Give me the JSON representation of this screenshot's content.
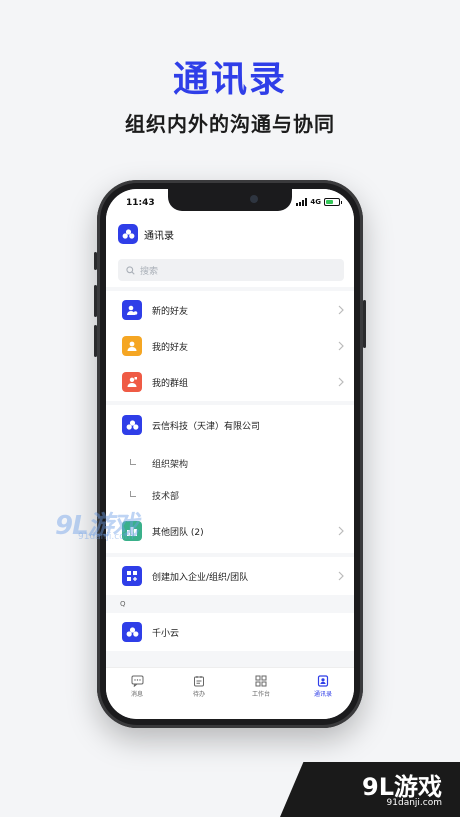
{
  "hero": {
    "title": "通讯录",
    "subtitle": "组织内外的沟通与协同"
  },
  "status": {
    "time": "11:43",
    "network": "4G"
  },
  "header": {
    "title": "通讯录"
  },
  "search": {
    "placeholder": "搜索"
  },
  "contacts": [
    {
      "label": "新的好友",
      "icon": "new-friend-icon",
      "color": "#2f3ee8"
    },
    {
      "label": "我的好友",
      "icon": "my-friends-icon",
      "color": "#f5a623"
    },
    {
      "label": "我的群组",
      "icon": "my-groups-icon",
      "color": "#ef5b45"
    }
  ],
  "org": {
    "name": "云信科技（天津）有限公司",
    "children": [
      "组织架构",
      "技术部"
    ],
    "other_teams": "其他团队 (2)"
  },
  "create": {
    "label": "创建加入企业/组织/团队"
  },
  "index_letter": "Q",
  "person": {
    "name": "千小云"
  },
  "tabs": [
    {
      "label": "消息",
      "icon": "message-icon",
      "active": false
    },
    {
      "label": "待办",
      "icon": "todo-icon",
      "active": false
    },
    {
      "label": "工作台",
      "icon": "workbench-icon",
      "active": false
    },
    {
      "label": "通讯录",
      "icon": "contacts-icon",
      "active": true
    }
  ],
  "watermark": {
    "logo": "9L游戏",
    "url": "91danji.com"
  },
  "corner": {
    "logo": "9L游戏",
    "url": "91danji.com"
  },
  "colors": {
    "brand": "#2f3ee8",
    "orange": "#f5a623",
    "red": "#ef5b45"
  }
}
